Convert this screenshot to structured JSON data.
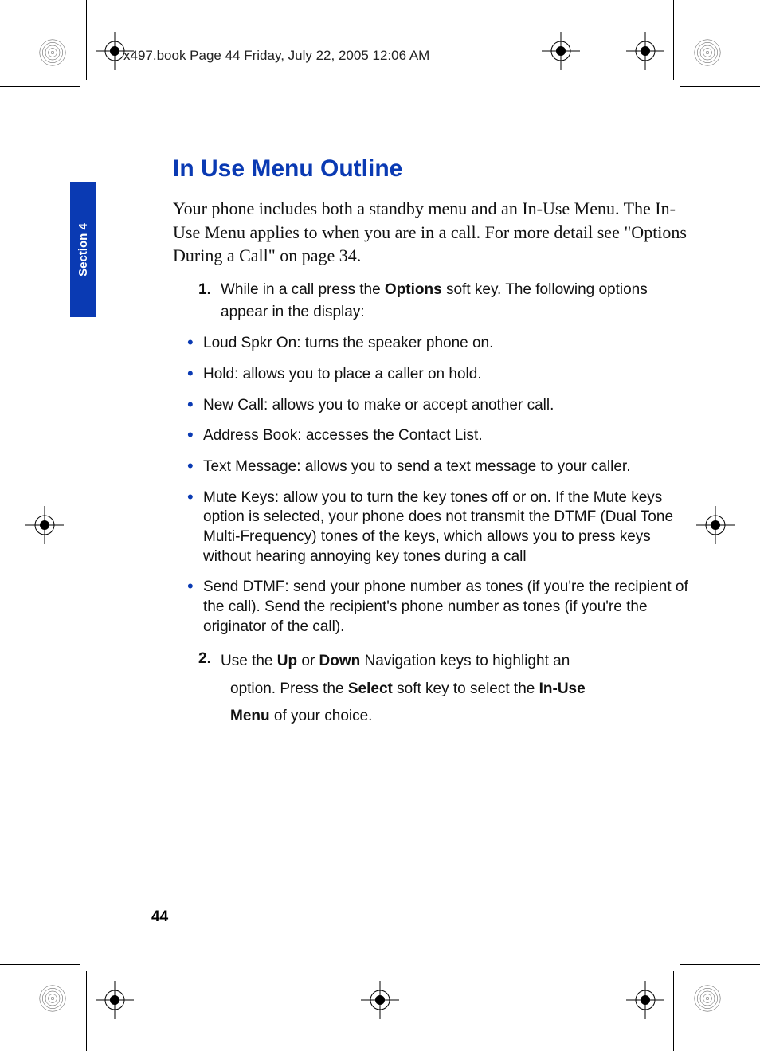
{
  "header": "x497.book  Page 44  Friday, July 22, 2005  12:06 AM",
  "sectionTab": "Section 4",
  "heading": "In Use Menu Outline",
  "intro": "Your phone includes both a standby menu and an In-Use Menu.  The In-Use Menu applies to when you are in a call.  For more detail see \"Options During a Call\" on page 34.",
  "step1": {
    "num": "1.",
    "text_before": "While in a call press the ",
    "bold1": "Options",
    "text_after": " soft key. The following options appear in the display:"
  },
  "bullets": [
    "Loud Spkr On: turns the speaker phone on.",
    "Hold: allows you to place a caller on hold.",
    "New Call: allows you to make or accept another call.",
    "Address Book: accesses the Contact List.",
    "Text Message: allows you to send a text message to your caller.",
    "Mute Keys: allow you to turn the key tones off or on. If the Mute keys option is selected, your phone does not transmit the DTMF (Dual Tone Multi-Frequency) tones of the keys, which allows you to press keys without hearing annoying key tones during a call",
    "Send DTMF: send your phone number as tones (if you're the recipient of the call).  Send the recipient's phone number as tones (if you're the originator of the call)."
  ],
  "step2": {
    "num": "2.",
    "p1a": "Use the ",
    "p1b": "Up",
    "p1c": " or ",
    "p1d": "Down",
    "p1e": " Navigation keys to highlight an",
    "p2a": "option. Press the ",
    "p2b": "Select",
    "p2c": " soft key to select the ",
    "p2d": "In-Use",
    "p3a": "Menu",
    "p3b": " of your choice."
  },
  "pageNum": "44"
}
